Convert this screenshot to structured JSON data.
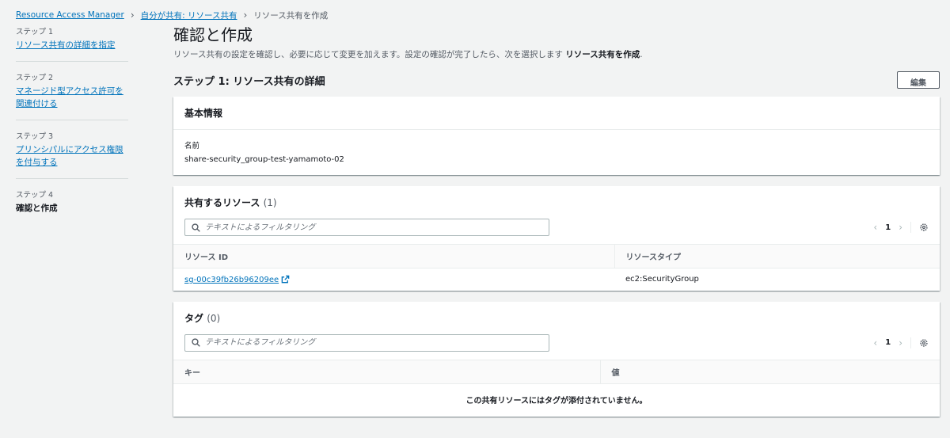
{
  "breadcrumb": {
    "items": [
      "Resource Access Manager",
      "自分が共有: リソース共有"
    ],
    "current": "リソース共有を作成"
  },
  "steps": [
    {
      "num": "ステップ 1",
      "label": "リソース共有の詳細を指定"
    },
    {
      "num": "ステップ 2",
      "label": "マネージド型アクセス許可を関連付ける"
    },
    {
      "num": "ステップ 3",
      "label": "プリンシパルにアクセス権限を付与する"
    },
    {
      "num": "ステップ 4",
      "label": "確認と作成"
    }
  ],
  "page": {
    "title": "確認と作成",
    "desc_prefix": "リソース共有の設定を確認し、必要に応じて変更を加えます。設定の確認が完了したら、次を選択します",
    "desc_strong": "リソース共有を作成",
    "desc_suffix": "."
  },
  "section": {
    "title": "ステップ 1: リソース共有の詳細",
    "edit_label": "編集"
  },
  "basic_info": {
    "header": "基本情報",
    "name_label": "名前",
    "name_value": "share-security_group-test-yamamoto-02"
  },
  "resources": {
    "header": "共有するリソース",
    "count": "(1)",
    "search_placeholder": "テキストによるフィルタリング",
    "page": "1",
    "columns": [
      "リソース ID",
      "リソースタイプ"
    ],
    "rows": [
      {
        "id": "sg-00c39fb26b96209ee",
        "type": "ec2:SecurityGroup"
      }
    ]
  },
  "tags": {
    "header": "タグ",
    "count": "(0)",
    "search_placeholder": "テキストによるフィルタリング",
    "page": "1",
    "columns": [
      "キー",
      "値"
    ],
    "empty": "この共有リソースにはタグが添付されていません。"
  }
}
